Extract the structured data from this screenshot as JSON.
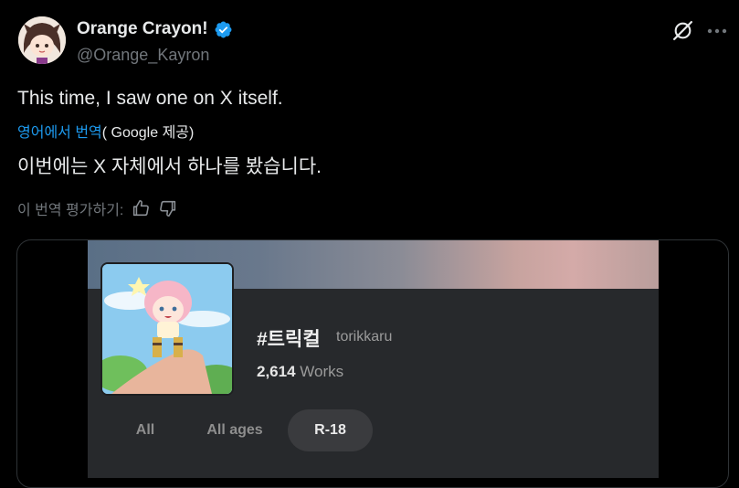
{
  "author": {
    "display_name": "Orange Crayon!",
    "handle": "@Orange_Kayron"
  },
  "tweet": {
    "text": "This time, I saw one on X itself.",
    "translate_link": "영어에서 번역",
    "translate_credit": "( Google 제공)",
    "translated_text": "이번에는 X 자체에서 하나를 봤습니다.",
    "rate_label": "이 번역 평가하기:"
  },
  "embedded_screenshot": {
    "tag_title": "#트릭컬",
    "tag_romaji": "torikkaru",
    "works_count": "2,614",
    "works_label": "Works",
    "filters": [
      "All",
      "All ages",
      "R-18"
    ],
    "active_filter": "R-18"
  },
  "colors": {
    "background": "#000000",
    "accent": "#1d9bf0",
    "text": "#e7e9ea",
    "muted": "#71767b"
  },
  "icons": [
    "verified-badge-icon",
    "grok-icon",
    "more-icon",
    "thumbs-up-icon",
    "thumbs-down-icon"
  ]
}
